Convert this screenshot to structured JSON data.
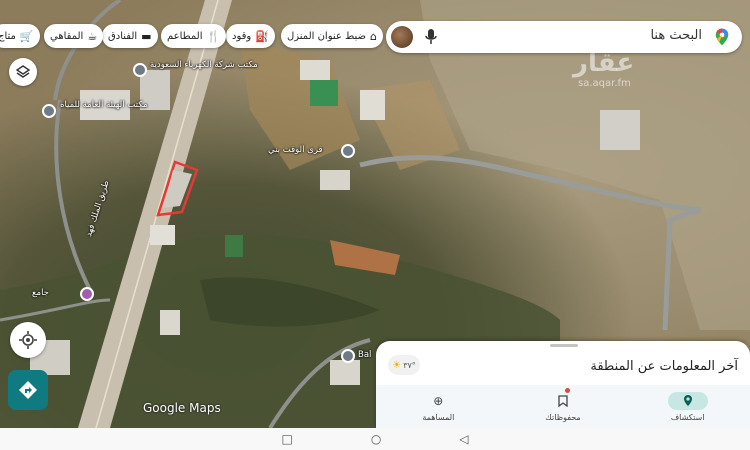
{
  "search": {
    "placeholder": "البحث هنا"
  },
  "chips": [
    {
      "label": "ضبط عنوان المنزل",
      "icon": "home-icon"
    },
    {
      "label": "وقود",
      "icon": "fuel-icon"
    },
    {
      "label": "المطاعم",
      "icon": "restaurant-icon"
    },
    {
      "label": "الفنادق",
      "icon": "hotel-icon"
    },
    {
      "label": "المقاهي",
      "icon": "coffee-icon"
    },
    {
      "label": "متاج",
      "icon": "shopping-cart-icon"
    }
  ],
  "map_labels": {
    "company": "مكتب شركة الكهرباء السعودية",
    "water": "مكتب الهيئة العامة للمياه",
    "village": "قرى الوقت بني",
    "road": "طريق الملك فهد",
    "mosque": "جامع",
    "poi_bottom": "Bal"
  },
  "watermark": {
    "brand": "عقار",
    "site": "sa.aqar.fm"
  },
  "google_logo": "Google Maps",
  "sheet": {
    "title": "آخر المعلومات عن المنطقة",
    "weather": "٣٧°"
  },
  "tabs": [
    {
      "label": "استكشاف",
      "icon": "explore-pin-icon",
      "active": true
    },
    {
      "label": "محفوظاتك",
      "icon": "bookmark-icon",
      "active": false
    },
    {
      "label": "المساهمة",
      "icon": "add-circle-icon",
      "active": false
    }
  ],
  "system_nav": {
    "back": "◁",
    "home": "○",
    "recents": "□"
  },
  "colors": {
    "accent": "#0f7a80",
    "active_tab": "#c6e7e4",
    "highlight": "#e53935"
  }
}
